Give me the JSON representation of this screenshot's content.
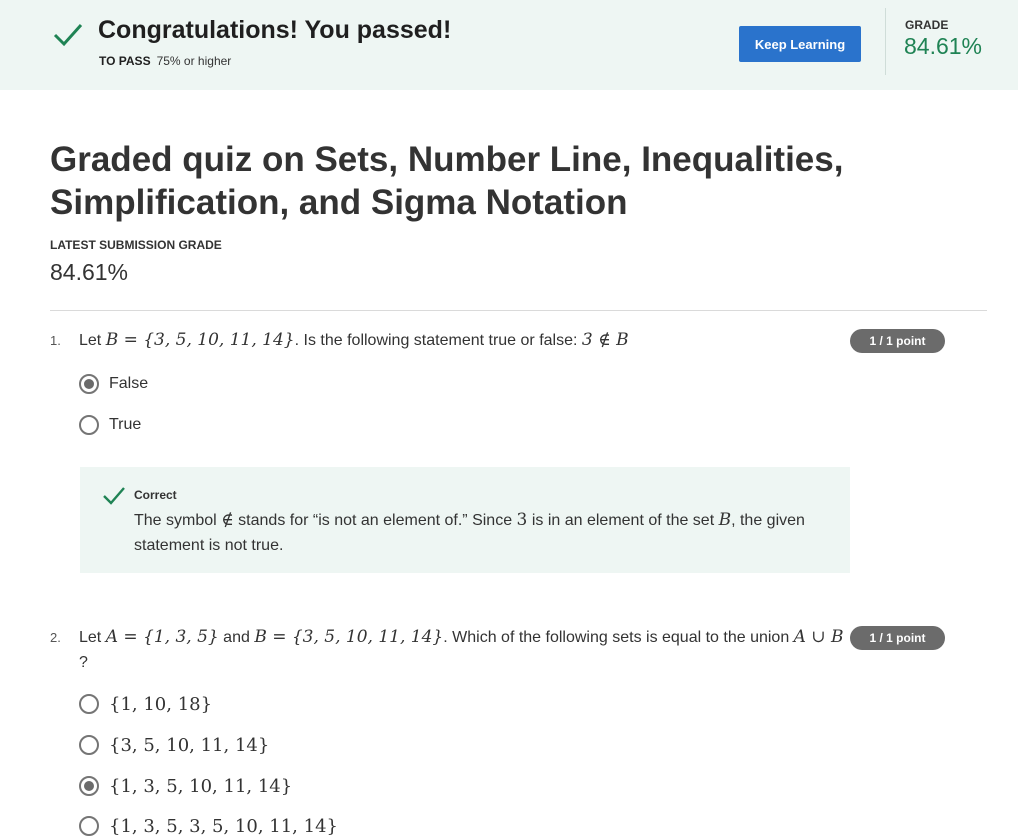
{
  "banner": {
    "title": "Congratulations! You passed!",
    "to_pass_label": "TO PASS",
    "to_pass_value": "75% or higher",
    "keep_learning": "Keep Learning",
    "grade_label": "GRADE",
    "grade_value": "84.61%",
    "check_icon": "check-icon",
    "accent_color": "#1f8354",
    "button_color": "#2a73cc"
  },
  "quiz": {
    "title": "Graded quiz on Sets, Number Line, Inequalities, Simplification, and Sigma Notation",
    "latest_label": "LATEST SUBMISSION GRADE",
    "latest_value": "84.61%"
  },
  "questions": [
    {
      "number": "1.",
      "text_before": "Let ",
      "math_1": "B = {3, 5, 10, 11, 14}",
      "text_after": ". Is the following statement true or false: ",
      "math_2": "3 ∉ B",
      "points": "1 / 1 point",
      "options": [
        {
          "label": "False",
          "selected": true
        },
        {
          "label": "True",
          "selected": false
        }
      ],
      "feedback": {
        "heading": "Correct",
        "t1": "The symbol ",
        "m1": "∉",
        "t2": " stands for “is not an element of.” Since ",
        "m2": "3",
        "t3": " is in an element of the set ",
        "m3": "B",
        "t4": ", the given statement is not true."
      }
    },
    {
      "number": "2.",
      "text_before": "Let ",
      "math_1": "A = {1, 3, 5}",
      "text_mid": " and ",
      "math_2": "B = {3, 5, 10, 11, 14}",
      "text_after": ". Which of the following sets is equal to the union ",
      "math_3": "A ∪ B",
      "text_end": "?",
      "points": "1 / 1 point",
      "options": [
        {
          "label": "{1, 10, 18}",
          "selected": false
        },
        {
          "label": "{3, 5, 10, 11, 14}",
          "selected": false
        },
        {
          "label": "{1, 3, 5, 10, 11, 14}",
          "selected": true
        },
        {
          "label": "{1, 3, 5, 3, 5, 10, 11, 14}",
          "selected": false
        }
      ]
    }
  ]
}
